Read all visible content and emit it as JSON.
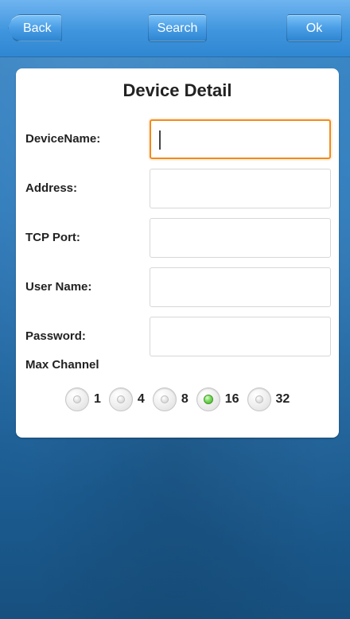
{
  "header": {
    "back_label": "Back",
    "search_label": "Search",
    "ok_label": "Ok"
  },
  "card": {
    "title": "Device Detail",
    "fields": [
      {
        "label": "DeviceName:",
        "value": "",
        "placeholder": ""
      },
      {
        "label": "Address:",
        "value": "",
        "placeholder": ""
      },
      {
        "label": "TCP Port:",
        "value": "",
        "placeholder": ""
      },
      {
        "label": "User Name:",
        "value": "",
        "placeholder": ""
      },
      {
        "label": "Password:",
        "value": "",
        "placeholder": ""
      }
    ],
    "max_channel": {
      "label": "Max Channel",
      "options": [
        "1",
        "4",
        "8",
        "16",
        "32"
      ],
      "selected": "16"
    }
  },
  "colors": {
    "accent_orange": "#f28b1a",
    "selected_green": "#4cae2f",
    "header_blue": "#2f86d1"
  },
  "icons": {
    "back": "chevron-left-icon"
  }
}
